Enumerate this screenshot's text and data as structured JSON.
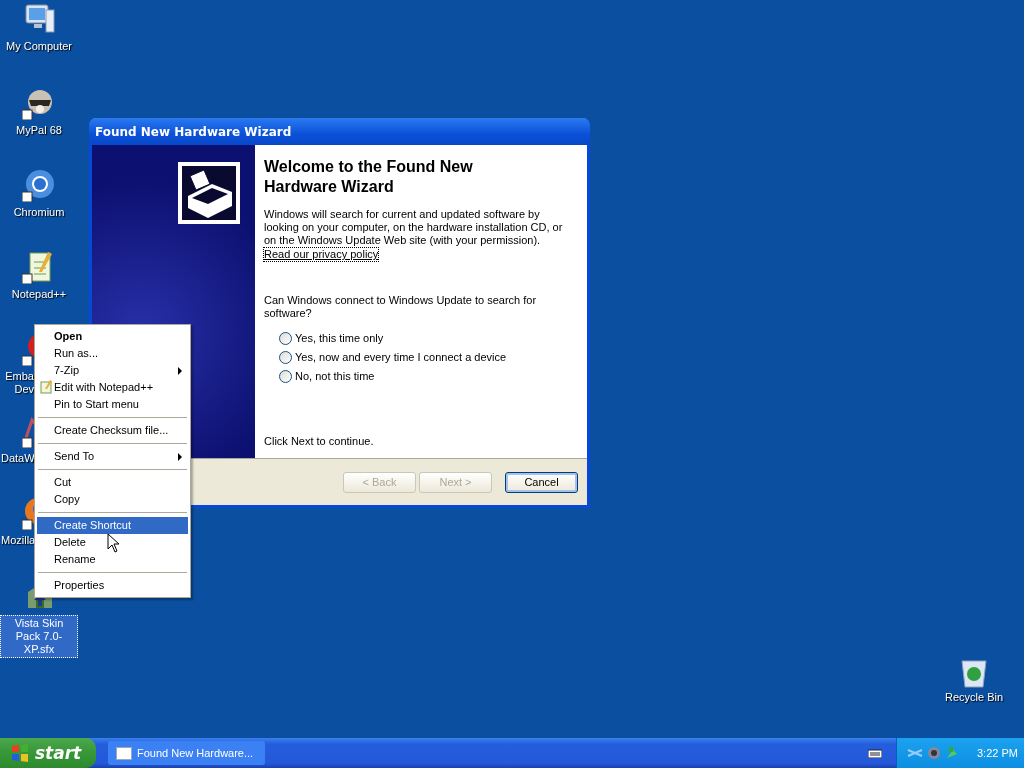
{
  "desktop_icons": [
    {
      "label": "My Computer",
      "kind": "computer",
      "covered": false,
      "selected": false
    },
    {
      "label": "MyPal 68",
      "kind": "mascot",
      "covered": false,
      "selected": false
    },
    {
      "label": "Chromium",
      "kind": "globe",
      "covered": false,
      "selected": false
    },
    {
      "label": "Notepad++",
      "kind": "notepad",
      "covered": false,
      "selected": false
    },
    {
      "label": "Emba Dev",
      "kind": "app",
      "covered": true,
      "selected": false
    },
    {
      "label": "DataW",
      "kind": "chart",
      "covered": true,
      "selected": false
    },
    {
      "label": "Mozilla",
      "kind": "browser",
      "covered": true,
      "selected": false
    },
    {
      "label": "Vista Skin Pack 7.0-XP.sfx",
      "kind": "installer",
      "covered": false,
      "selected": true
    }
  ],
  "recycle_bin": {
    "label": "Recycle Bin"
  },
  "window": {
    "title": "Found New Hardware Wizard",
    "heading": "Welcome to the Found New Hardware Wizard",
    "intro": "Windows will search for current and updated software by looking on your computer, on the hardware installation CD, or on the Windows Update Web site (with your permission).",
    "privacy_link": "Read our privacy policy",
    "question": "Can Windows connect to Windows Update to search for software?",
    "options": [
      {
        "label": "Yes, this time only",
        "selected": false
      },
      {
        "label": "Yes, now and every time I connect a device",
        "selected": false
      },
      {
        "label": "No, not this time",
        "selected": false
      }
    ],
    "footer": "Click Next to continue.",
    "buttons": [
      {
        "label": "< Back",
        "disabled": true,
        "default": false
      },
      {
        "label": "Next >",
        "disabled": true,
        "default": false
      },
      {
        "label": "Cancel",
        "disabled": false,
        "default": true
      }
    ]
  },
  "context_menu": [
    {
      "kind": "item",
      "label": "Open",
      "bold": true,
      "submenu": false,
      "selected": false
    },
    {
      "kind": "item",
      "label": "Run as...",
      "bold": false,
      "submenu": false,
      "selected": false
    },
    {
      "kind": "item",
      "label": "7-Zip",
      "bold": false,
      "submenu": true,
      "selected": false
    },
    {
      "kind": "icon_item",
      "label": "Edit with Notepad++",
      "bold": false,
      "submenu": false,
      "selected": false
    },
    {
      "kind": "item",
      "label": "Pin to Start menu",
      "bold": false,
      "submenu": false,
      "selected": false
    },
    {
      "kind": "separator"
    },
    {
      "kind": "item",
      "label": "Create Checksum file...",
      "bold": false,
      "submenu": false,
      "selected": false
    },
    {
      "kind": "separator"
    },
    {
      "kind": "item",
      "label": "Send To",
      "bold": false,
      "submenu": true,
      "selected": false
    },
    {
      "kind": "separator"
    },
    {
      "kind": "item",
      "label": "Cut",
      "bold": false,
      "submenu": false,
      "selected": false
    },
    {
      "kind": "item",
      "label": "Copy",
      "bold": false,
      "submenu": false,
      "selected": false
    },
    {
      "kind": "separator"
    },
    {
      "kind": "item",
      "label": "Create Shortcut",
      "bold": false,
      "submenu": false,
      "selected": true
    },
    {
      "kind": "item",
      "label": "Delete",
      "bold": false,
      "submenu": false,
      "selected": false
    },
    {
      "kind": "item",
      "label": "Rename",
      "bold": false,
      "submenu": false,
      "selected": false
    },
    {
      "kind": "separator"
    },
    {
      "kind": "item",
      "label": "Properties",
      "bold": false,
      "submenu": false,
      "selected": false
    }
  ],
  "taskbar": {
    "start": "start",
    "tasks": [
      {
        "label": "Found New Hardware...",
        "selected": false
      }
    ],
    "clock": "3:22 PM"
  }
}
